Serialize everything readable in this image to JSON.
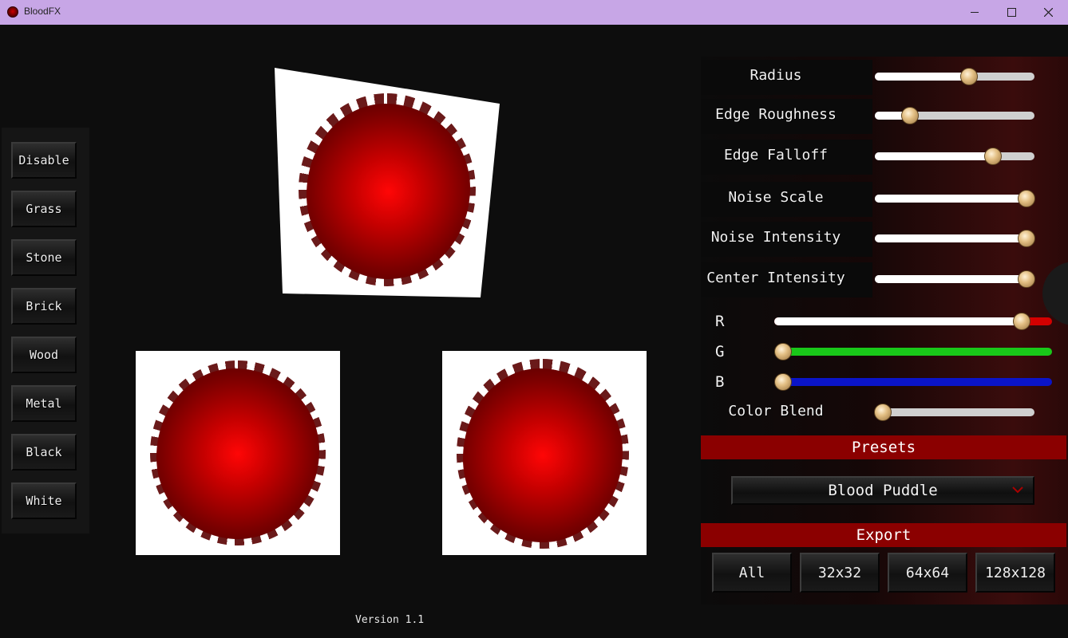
{
  "window": {
    "title": "BloodFX"
  },
  "materials": [
    "Disable",
    "Grass",
    "Stone",
    "Brick",
    "Wood",
    "Metal",
    "Black",
    "White"
  ],
  "version": "Version 1.1",
  "params": [
    {
      "label": "Radius",
      "value": 0.59
    },
    {
      "label": "Edge Roughness",
      "value": 0.22
    },
    {
      "label": "Edge Falloff",
      "value": 0.74
    },
    {
      "label": "Noise Scale",
      "value": 0.95
    },
    {
      "label": "Noise Intensity",
      "value": 0.95
    },
    {
      "label": "Center Intensity",
      "value": 0.95
    }
  ],
  "color": {
    "r_label": "R",
    "r_value": 0.89,
    "r_color": "#d40000",
    "g_label": "G",
    "g_value": 0.0,
    "g_color": "#19c819",
    "b_label": "B",
    "b_value": 0.0,
    "b_color": "#0a14c8"
  },
  "color_blend": {
    "label": "Color Blend",
    "value": 0.05
  },
  "presets": {
    "heading": "Presets",
    "selected": "Blood Puddle"
  },
  "export": {
    "heading": "Export",
    "buttons": [
      "All",
      "32x32",
      "64x64",
      "128x128"
    ]
  },
  "accent": "#8b0000"
}
